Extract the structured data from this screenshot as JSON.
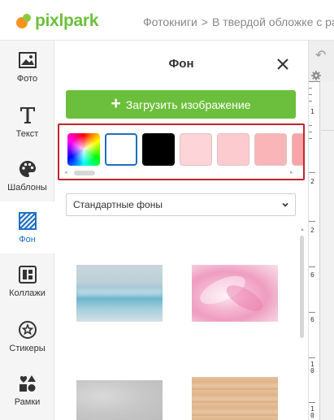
{
  "header": {
    "logo_text": "pixlpark",
    "breadcrumb": [
      "Фотокниги",
      "В твердой обложке с ра"
    ],
    "breadcrumb_separator": ">"
  },
  "toolbar": {
    "items": [
      {
        "label": "Фото",
        "icon": "image-icon",
        "active": false
      },
      {
        "label": "Текст",
        "icon": "text-icon",
        "active": false
      },
      {
        "label": "Шаблоны",
        "icon": "palette-icon",
        "active": false
      },
      {
        "label": "Фон",
        "icon": "background-pattern-icon",
        "active": true
      },
      {
        "label": "Коллажи",
        "icon": "collage-icon",
        "active": false
      },
      {
        "label": "Стикеры",
        "icon": "sticker-icon",
        "active": false
      },
      {
        "label": "Рамки",
        "icon": "frame-shapes-icon",
        "active": false
      }
    ]
  },
  "panel": {
    "title": "Фон",
    "upload_label": "Загрузить изображение",
    "swatches": [
      {
        "type": "gradient",
        "name": "color-picker"
      },
      {
        "type": "color",
        "color": "#ffffff",
        "selected": true
      },
      {
        "type": "color",
        "color": "#000000"
      },
      {
        "type": "color",
        "color": "#fdd5d8"
      },
      {
        "type": "color",
        "color": "#fccbcf"
      },
      {
        "type": "color",
        "color": "#fab5b9"
      },
      {
        "type": "color",
        "color": "#f8a4a8"
      }
    ],
    "dropdown_value": "Стандартные фоны",
    "thumbnails": [
      "sea",
      "flower",
      "concrete",
      "wood"
    ]
  },
  "colors": {
    "brand_green": "#6cbf3c",
    "accent_blue": "#1e6fc0",
    "highlight_red": "#c0262a"
  },
  "ruler": {
    "labels": [
      "1",
      "2",
      "2",
      "6",
      "6",
      "1\n0",
      "1\n0"
    ]
  }
}
